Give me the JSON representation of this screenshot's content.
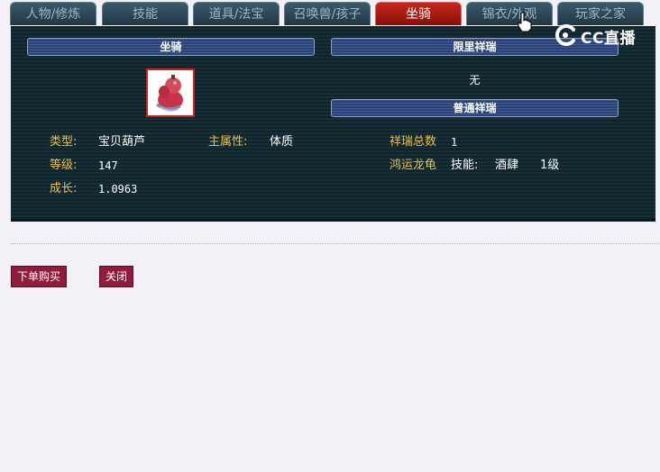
{
  "tabs": [
    {
      "label": "人物/修炼"
    },
    {
      "label": "技能"
    },
    {
      "label": "道具/法宝"
    },
    {
      "label": "召唤兽/孩子"
    },
    {
      "label": "坐骑"
    },
    {
      "label": "锦衣/外观"
    },
    {
      "label": "玩家之家"
    }
  ],
  "active_tab": "坐骑",
  "sections": {
    "mount_header": "坐骑",
    "limited_header": "限里祥瑞",
    "limited_value": "无",
    "normal_header": "普通祥瑞"
  },
  "mount": {
    "type_label": "类型:",
    "type_value": "宝贝葫芦",
    "main_attr_label": "主属性:",
    "main_attr_value": "体质",
    "level_label": "等级:",
    "level_value": "147",
    "growth_label": "成长:",
    "growth_value": "1.0963"
  },
  "xiangrui": {
    "total_label": "祥瑞总数",
    "total_value": "1",
    "name": "鸿运龙龟",
    "skill_label": "技能:",
    "skill_name": "酒肆",
    "skill_level": "1级"
  },
  "buttons": {
    "buy": "下单购买",
    "close": "关闭"
  },
  "overlay": {
    "logo_text": "CC直播"
  },
  "colors": {
    "active_tab": "#b81e14",
    "label": "#e8c04a",
    "button": "#8f1c3a",
    "panel": "#10222a"
  }
}
